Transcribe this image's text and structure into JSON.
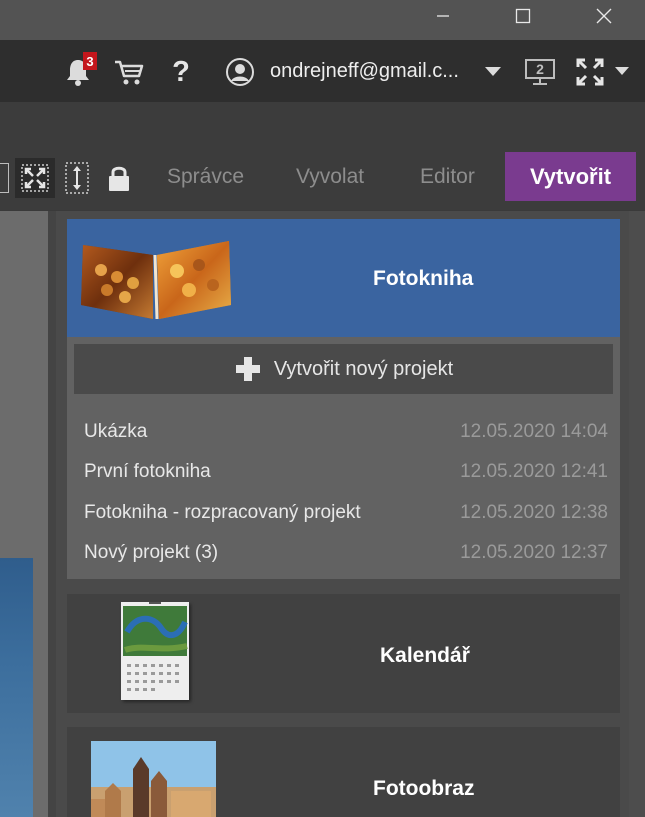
{
  "window": {
    "minimize_icon": "minimize-icon",
    "maximize_icon": "maximize-icon",
    "close_icon": "close-icon"
  },
  "topbar": {
    "notification_count": "3",
    "account_email": "ondrejneff@gmail.c...",
    "monitor_number": "2"
  },
  "modules": {
    "tabs": [
      "Správce",
      "Vyvolat",
      "Editor",
      "Vytvořit"
    ],
    "active": "Vytvořit",
    "active_color": "#7a3b8f"
  },
  "create": {
    "photobook": {
      "title": "Fotokniha",
      "header_color": "#3a64a0",
      "new_project_label": "Vytvořit nový projekt",
      "projects": [
        {
          "name": "Ukázka",
          "date": "12.05.2020 14:04"
        },
        {
          "name": "První fotokniha",
          "date": "12.05.2020 12:41"
        },
        {
          "name": "Fotokniha - rozpracovaný projekt",
          "date": "12.05.2020 12:38"
        },
        {
          "name": "Nový projekt (3)",
          "date": "12.05.2020 12:37"
        }
      ]
    },
    "calendar": {
      "title": "Kalendář"
    },
    "canvas": {
      "title": "Fotoobraz"
    }
  }
}
